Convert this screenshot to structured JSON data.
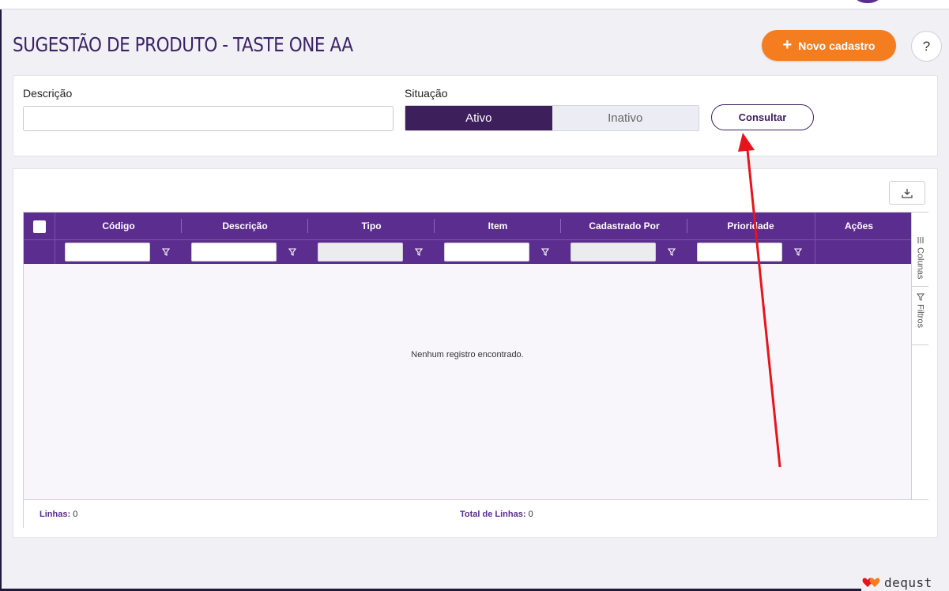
{
  "page": {
    "title": "SUGESTÃO DE PRODUTO - TASTE ONE AA",
    "new_button_label": "Novo cadastro",
    "help_label": "?"
  },
  "filters": {
    "descricao_label": "Descrição",
    "descricao_value": "",
    "situacao_label": "Situação",
    "situacao_options": [
      "Ativo",
      "Inativo"
    ],
    "situacao_selected": "Ativo",
    "consultar_label": "Consultar"
  },
  "grid": {
    "columns": [
      "Código",
      "Descrição",
      "Tipo",
      "Item",
      "Cadastrado Por",
      "Prioridade",
      "Ações"
    ],
    "side_tabs": [
      "Colunas",
      "Filtros"
    ],
    "empty_message": "Nenhum registro encontrado.",
    "footer": {
      "linhas_label": "Linhas:",
      "linhas_value": "0",
      "total_label": "Total de Linhas:",
      "total_value": "0"
    }
  },
  "brand": {
    "name": "dequst"
  },
  "colors": {
    "primary_purple": "#5b2d8e",
    "dark_purple": "#3d1f5c",
    "accent_orange": "#f47d20",
    "annotation_red": "#e8141c"
  }
}
